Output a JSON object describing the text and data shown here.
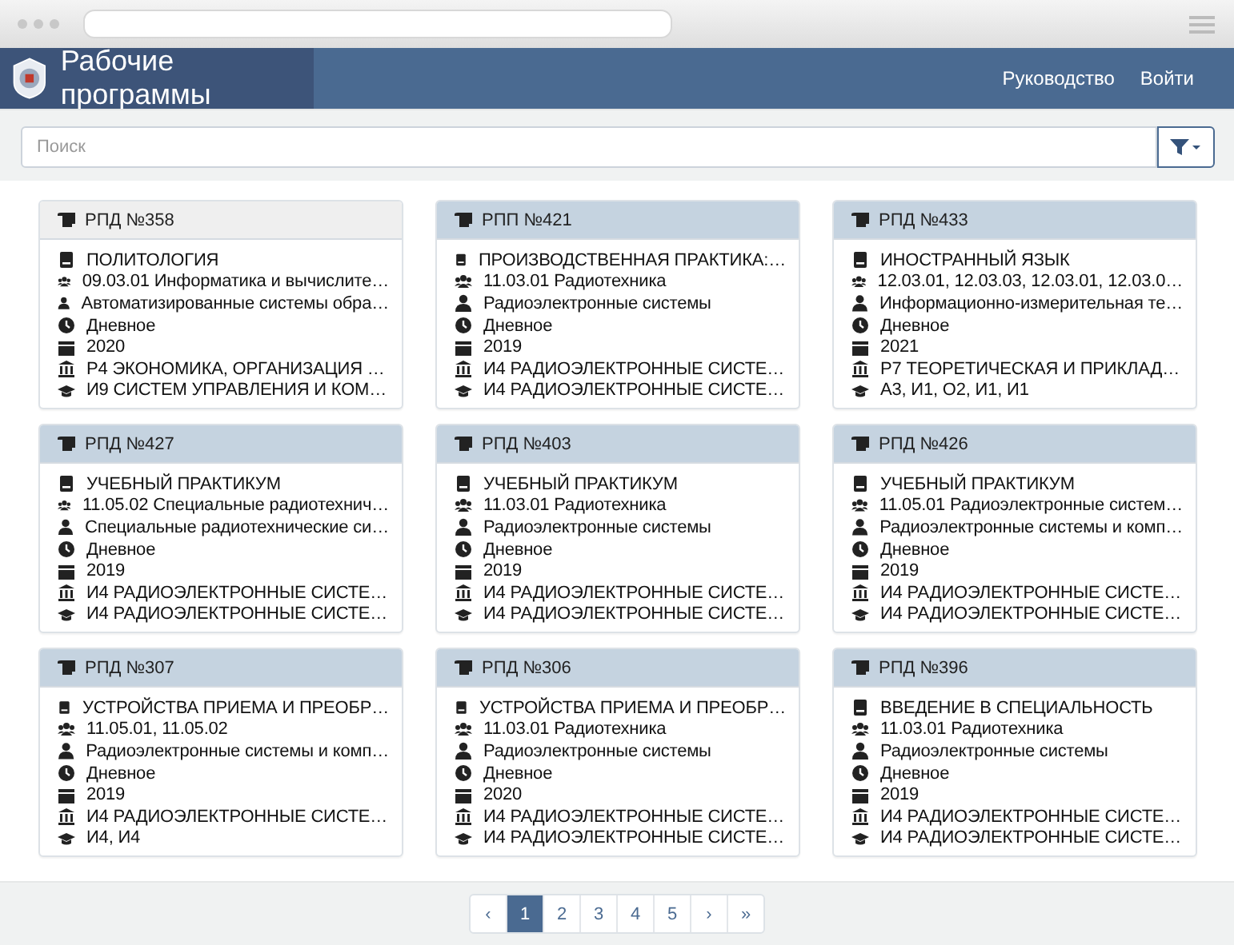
{
  "navbar": {
    "brand": "Рабочие программы",
    "links": [
      "Руководство",
      "Войти"
    ]
  },
  "search": {
    "placeholder": "Поиск"
  },
  "cards": [
    {
      "title": "РПД №358",
      "selected": true,
      "fields": [
        {
          "kind": "discipline",
          "text": "ПОЛИТОЛОГИЯ"
        },
        {
          "kind": "direction",
          "text": "09.03.01 Информатика и вычислите…"
        },
        {
          "kind": "profile",
          "text": "Автоматизированные системы обра…"
        },
        {
          "kind": "form",
          "text": "Дневное"
        },
        {
          "kind": "year",
          "text": "2020"
        },
        {
          "kind": "department",
          "text": "Р4 ЭКОНОМИКА, ОРГАНИЗАЦИЯ …"
        },
        {
          "kind": "institute",
          "text": "И9 СИСТЕМ УПРАВЛЕНИЯ И КОМ…"
        }
      ]
    },
    {
      "title": "РПП №421",
      "selected": false,
      "fields": [
        {
          "kind": "discipline",
          "text": "ПРОИЗВОДСТВЕННАЯ ПРАКТИКА:…"
        },
        {
          "kind": "direction",
          "text": "11.03.01 Радиотехника"
        },
        {
          "kind": "profile",
          "text": "Радиоэлектронные системы"
        },
        {
          "kind": "form",
          "text": "Дневное"
        },
        {
          "kind": "year",
          "text": "2019"
        },
        {
          "kind": "department",
          "text": "И4 РАДИОЭЛЕКТРОННЫЕ СИСТЕ…"
        },
        {
          "kind": "institute",
          "text": "И4 РАДИОЭЛЕКТРОННЫЕ СИСТЕ…"
        }
      ]
    },
    {
      "title": "РПД №433",
      "selected": false,
      "fields": [
        {
          "kind": "discipline",
          "text": "ИНОСТРАННЫЙ ЯЗЫК"
        },
        {
          "kind": "direction",
          "text": "12.03.01, 12.03.03, 12.03.01, 12.03.0…"
        },
        {
          "kind": "profile",
          "text": "Информационно-измерительная те…"
        },
        {
          "kind": "form",
          "text": "Дневное"
        },
        {
          "kind": "year",
          "text": "2021"
        },
        {
          "kind": "department",
          "text": "Р7 ТЕОРЕТИЧЕСКАЯ И ПРИКЛАД…"
        },
        {
          "kind": "institute",
          "text": "А3, И1, О2, И1, И1"
        }
      ]
    },
    {
      "title": "РПД №427",
      "selected": false,
      "fields": [
        {
          "kind": "discipline",
          "text": "УЧЕБНЫЙ ПРАКТИКУМ"
        },
        {
          "kind": "direction",
          "text": "11.05.02 Специальные радиотехнич…"
        },
        {
          "kind": "profile",
          "text": "Специальные радиотехнические си…"
        },
        {
          "kind": "form",
          "text": "Дневное"
        },
        {
          "kind": "year",
          "text": "2019"
        },
        {
          "kind": "department",
          "text": "И4 РАДИОЭЛЕКТРОННЫЕ СИСТЕ…"
        },
        {
          "kind": "institute",
          "text": "И4 РАДИОЭЛЕКТРОННЫЕ СИСТЕ…"
        }
      ]
    },
    {
      "title": "РПД №403",
      "selected": false,
      "fields": [
        {
          "kind": "discipline",
          "text": "УЧЕБНЫЙ ПРАКТИКУМ"
        },
        {
          "kind": "direction",
          "text": "11.03.01 Радиотехника"
        },
        {
          "kind": "profile",
          "text": "Радиоэлектронные системы"
        },
        {
          "kind": "form",
          "text": "Дневное"
        },
        {
          "kind": "year",
          "text": "2019"
        },
        {
          "kind": "department",
          "text": "И4 РАДИОЭЛЕКТРОННЫЕ СИСТЕ…"
        },
        {
          "kind": "institute",
          "text": "И4 РАДИОЭЛЕКТРОННЫЕ СИСТЕ…"
        }
      ]
    },
    {
      "title": "РПД №426",
      "selected": false,
      "fields": [
        {
          "kind": "discipline",
          "text": "УЧЕБНЫЙ ПРАКТИКУМ"
        },
        {
          "kind": "direction",
          "text": "11.05.01 Радиоэлектронные систем…"
        },
        {
          "kind": "profile",
          "text": "Радиоэлектронные системы и комп…"
        },
        {
          "kind": "form",
          "text": "Дневное"
        },
        {
          "kind": "year",
          "text": "2019"
        },
        {
          "kind": "department",
          "text": "И4 РАДИОЭЛЕКТРОННЫЕ СИСТЕ…"
        },
        {
          "kind": "institute",
          "text": "И4 РАДИОЭЛЕКТРОННЫЕ СИСТЕ…"
        }
      ]
    },
    {
      "title": "РПД №307",
      "selected": false,
      "fields": [
        {
          "kind": "discipline",
          "text": "УСТРОЙСТВА ПРИЕМА И ПРЕОБР…"
        },
        {
          "kind": "direction",
          "text": "11.05.01, 11.05.02"
        },
        {
          "kind": "profile",
          "text": "Радиоэлектронные системы и комп…"
        },
        {
          "kind": "form",
          "text": "Дневное"
        },
        {
          "kind": "year",
          "text": "2019"
        },
        {
          "kind": "department",
          "text": "И4 РАДИОЭЛЕКТРОННЫЕ СИСТЕ…"
        },
        {
          "kind": "institute",
          "text": "И4, И4"
        }
      ]
    },
    {
      "title": "РПД №306",
      "selected": false,
      "fields": [
        {
          "kind": "discipline",
          "text": "УСТРОЙСТВА ПРИЕМА И ПРЕОБР…"
        },
        {
          "kind": "direction",
          "text": "11.03.01 Радиотехника"
        },
        {
          "kind": "profile",
          "text": "Радиоэлектронные системы"
        },
        {
          "kind": "form",
          "text": "Дневное"
        },
        {
          "kind": "year",
          "text": "2020"
        },
        {
          "kind": "department",
          "text": "И4 РАДИОЭЛЕКТРОННЫЕ СИСТЕ…"
        },
        {
          "kind": "institute",
          "text": "И4 РАДИОЭЛЕКТРОННЫЕ СИСТЕ…"
        }
      ]
    },
    {
      "title": "РПД №396",
      "selected": false,
      "fields": [
        {
          "kind": "discipline",
          "text": "ВВЕДЕНИЕ В СПЕЦИАЛЬНОСТЬ"
        },
        {
          "kind": "direction",
          "text": "11.03.01 Радиотехника"
        },
        {
          "kind": "profile",
          "text": "Радиоэлектронные системы"
        },
        {
          "kind": "form",
          "text": "Дневное"
        },
        {
          "kind": "year",
          "text": "2019"
        },
        {
          "kind": "department",
          "text": "И4 РАДИОЭЛЕКТРОННЫЕ СИСТЕ…"
        },
        {
          "kind": "institute",
          "text": "И4 РАДИОЭЛЕКТРОННЫЕ СИСТЕ…"
        }
      ]
    }
  ],
  "pagination": [
    {
      "label": "‹",
      "selected": false
    },
    {
      "label": "1",
      "selected": true
    },
    {
      "label": "2",
      "selected": false
    },
    {
      "label": "3",
      "selected": false
    },
    {
      "label": "4",
      "selected": false
    },
    {
      "label": "5",
      "selected": false
    },
    {
      "label": "›",
      "selected": false
    },
    {
      "label": "»",
      "selected": false
    }
  ]
}
